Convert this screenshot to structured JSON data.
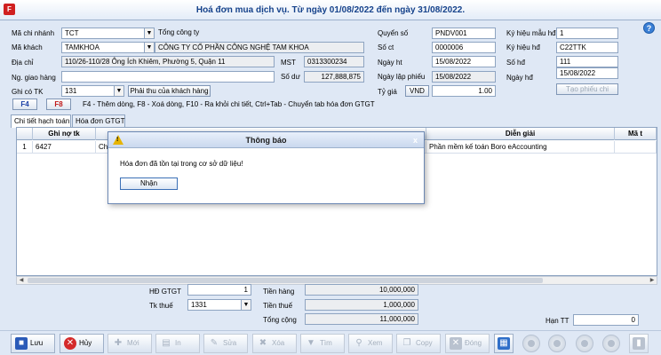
{
  "window": {
    "title": "Hoá đơn mua dịch vụ. Từ ngày 01/08/2022 đến ngày 31/08/2022."
  },
  "form": {
    "branch_label": "Mã chi nhánh",
    "branch_code": "TCT",
    "branch_name": "Tổng công ty",
    "customer_label": "Mã khách",
    "customer_code": "TAMKHOA",
    "customer_name": "CÔNG TY CỔ PHẦN CÔNG NGHỆ TAM KHOA",
    "address_label": "Địa chỉ",
    "address": "110/26-110/28 Ông Ích Khiêm, Phường 5, Quận 11",
    "mst_label": "MST",
    "mst": "0313300234",
    "delivery_label": "Ng. giao hàng",
    "delivery": "",
    "balance_label": "Số dư",
    "balance": "127,888,875",
    "credit_account_label": "Ghi có TK",
    "credit_account": "131",
    "receivable_button": "Phải thu của khách hàng",
    "book_label": "Quyển số",
    "book": "PNDV001",
    "voucher_no_label": "Số ct",
    "voucher_no": "0000006",
    "date_label": "Ngày ht",
    "date": "15/08/2022",
    "created_date_label": "Ngày lập phiếu",
    "created_date": "15/08/2022",
    "rate_label": "Tỷ giá",
    "currency": "VND",
    "rate": "1.00",
    "template_label": "Ký hiệu mẫu hđ",
    "template": "1",
    "symbol_label": "Ký hiệu hđ",
    "symbol": "C22TTK",
    "invoice_no_label": "Số hđ",
    "invoice_no": "111",
    "invoice_date_label": "Ngày hđ",
    "invoice_date": "15/08/2022",
    "create_voucher_button": "Tạo phiếu chi"
  },
  "shortcuts": {
    "f4": "F4",
    "f8": "F8",
    "hint": "F4 - Thêm dòng, F8 - Xoá dòng, F10 - Ra khỏi chi tiết, Ctrl+Tab - Chuyển tab hóa đơn GTGT"
  },
  "tabs": [
    "Chi tiết hạch toán",
    "Hóa đơn GTGT"
  ],
  "grid": {
    "headers": [
      "Ghi nợ tk",
      "Diễn giải",
      "Mã t"
    ],
    "rows": [
      {
        "index": "1",
        "debit_account": "6427",
        "partial": "Ch",
        "description": "Phần mềm kế toán Boro eAccounting"
      }
    ]
  },
  "dialog": {
    "title": "Thông báo",
    "close": "x",
    "message": "Hóa đơn đã tồn tại trong cơ sở dữ liệu!",
    "ok": "Nhận"
  },
  "totals": {
    "vat_invoice_label": "HĐ GTGT",
    "vat_invoice": "1",
    "tax_account_label": "Tk thuế",
    "tax_account": "1331",
    "goods_label": "Tiền hàng",
    "goods": "10,000,000",
    "tax_label": "Tiền thuế",
    "tax": "1,000,000",
    "total_label": "Tổng cộng",
    "total": "11,000,000",
    "due_label": "Hạn TT",
    "due": "0"
  },
  "toolbar": {
    "save": "Lưu",
    "cancel": "Hủy",
    "new": "Mới",
    "print": "In",
    "edit": "Sửa",
    "delete": "Xóa",
    "find": "Tìm",
    "view": "Xem",
    "copy": "Copy",
    "close": "Đóng"
  }
}
